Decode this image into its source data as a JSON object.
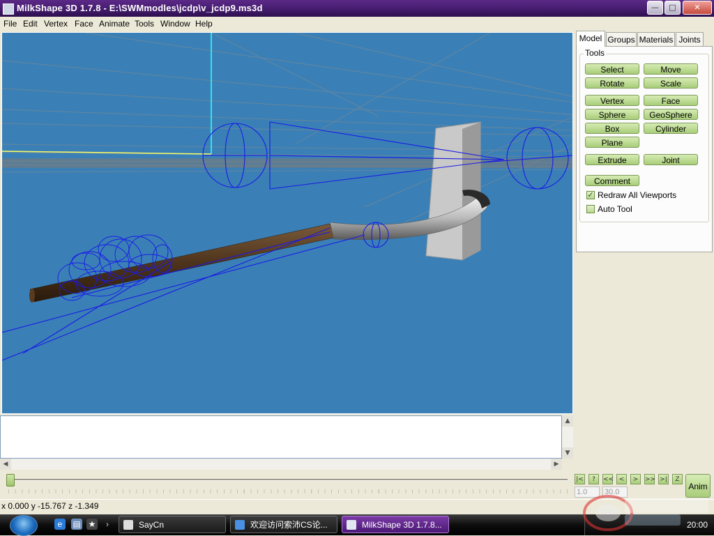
{
  "window": {
    "title": "MilkShape 3D 1.7.8 - E:\\SWMmodles\\jcdp\\v_jcdp9.ms3d"
  },
  "menu": [
    "File",
    "Edit",
    "Vertex",
    "Face",
    "Animate",
    "Tools",
    "Window",
    "Help"
  ],
  "tabs": [
    "Model",
    "Groups",
    "Materials",
    "Joints"
  ],
  "panel": {
    "group_label": "Tools",
    "buttons": {
      "select": "Select",
      "move": "Move",
      "rotate": "Rotate",
      "scale": "Scale",
      "vertex": "Vertex",
      "face": "Face",
      "sphere": "Sphere",
      "geosphere": "GeoSphere",
      "box": "Box",
      "cylinder": "Cylinder",
      "plane": "Plane",
      "extrude": "Extrude",
      "joint": "Joint",
      "comment": "Comment"
    },
    "checkboxes": [
      {
        "label": "Redraw All Viewports",
        "checked": true
      },
      {
        "label": "Auto Tool",
        "checked": false
      }
    ]
  },
  "animation": {
    "frame_start": "1.0",
    "frame_end": "30.0",
    "anim_button": "Anim",
    "slider_value": 0
  },
  "status": {
    "coords": "x 0.000 y -15.767 z -1.349"
  },
  "taskbar": {
    "items": [
      "SayCn",
      "欢迎访问索沛CS论...",
      "MilkShape 3D 1.7.8..."
    ],
    "active_index": 2,
    "clock": "20:00"
  },
  "colors": {
    "viewport_bg": "#3a80b6",
    "wireframe": "#1a1ae6",
    "tool_button": "#a8cd79",
    "title_bar": "#4a1f74"
  }
}
